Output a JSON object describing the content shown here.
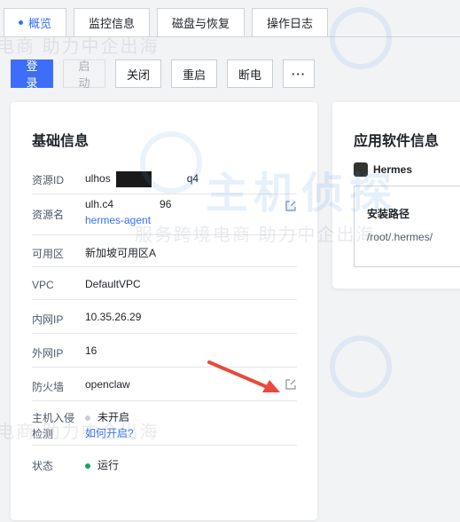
{
  "tabs": [
    {
      "label": "概览",
      "active": true
    },
    {
      "label": "监控信息",
      "active": false
    },
    {
      "label": "磁盘与恢复",
      "active": false
    },
    {
      "label": "操作日志",
      "active": false
    }
  ],
  "toolbar": {
    "login": "登录",
    "start": "启动",
    "stop": "关闭",
    "restart": "重启",
    "poweroff": "断电",
    "more": "···"
  },
  "basic": {
    "title": "基础信息",
    "resource_id_label": "资源ID",
    "resource_id_prefix": "ulhos",
    "resource_id_suffix": "q4",
    "resource_name_label": "资源名",
    "resource_name_prefix": "ulh.c4",
    "resource_name_suffix": "96",
    "resource_name_link": "hermes-agent",
    "zone_label": "可用区",
    "zone_value": "新加坡可用区A",
    "vpc_label": "VPC",
    "vpc_value": "DefaultVPC",
    "private_ip_label": "内网IP",
    "private_ip_value": "10.35.26.29",
    "public_ip_label": "外网IP",
    "public_ip_value": "16",
    "firewall_label": "防火墙",
    "firewall_value": "openclaw",
    "intrusion_label_1": "主机入侵",
    "intrusion_label_2": "检测",
    "intrusion_value": "未开启",
    "intrusion_link": "如何开启?",
    "status_label": "状态",
    "status_value": "运行"
  },
  "app": {
    "title": "应用软件信息",
    "name": "Hermes",
    "install_path_label": "安装路径",
    "install_path_value": "/root/.hermes/"
  },
  "watermark": {
    "line": "电商  助力中企出海",
    "line2": "服务跨境电商  助力中企出海",
    "brand": "主机侦探"
  },
  "colors": {
    "accent": "#3370ff",
    "primary_button": "#3e6ef7",
    "status_running": "#19a35a",
    "status_off": "#c9cdd4",
    "arrow": "#e84a3b"
  }
}
